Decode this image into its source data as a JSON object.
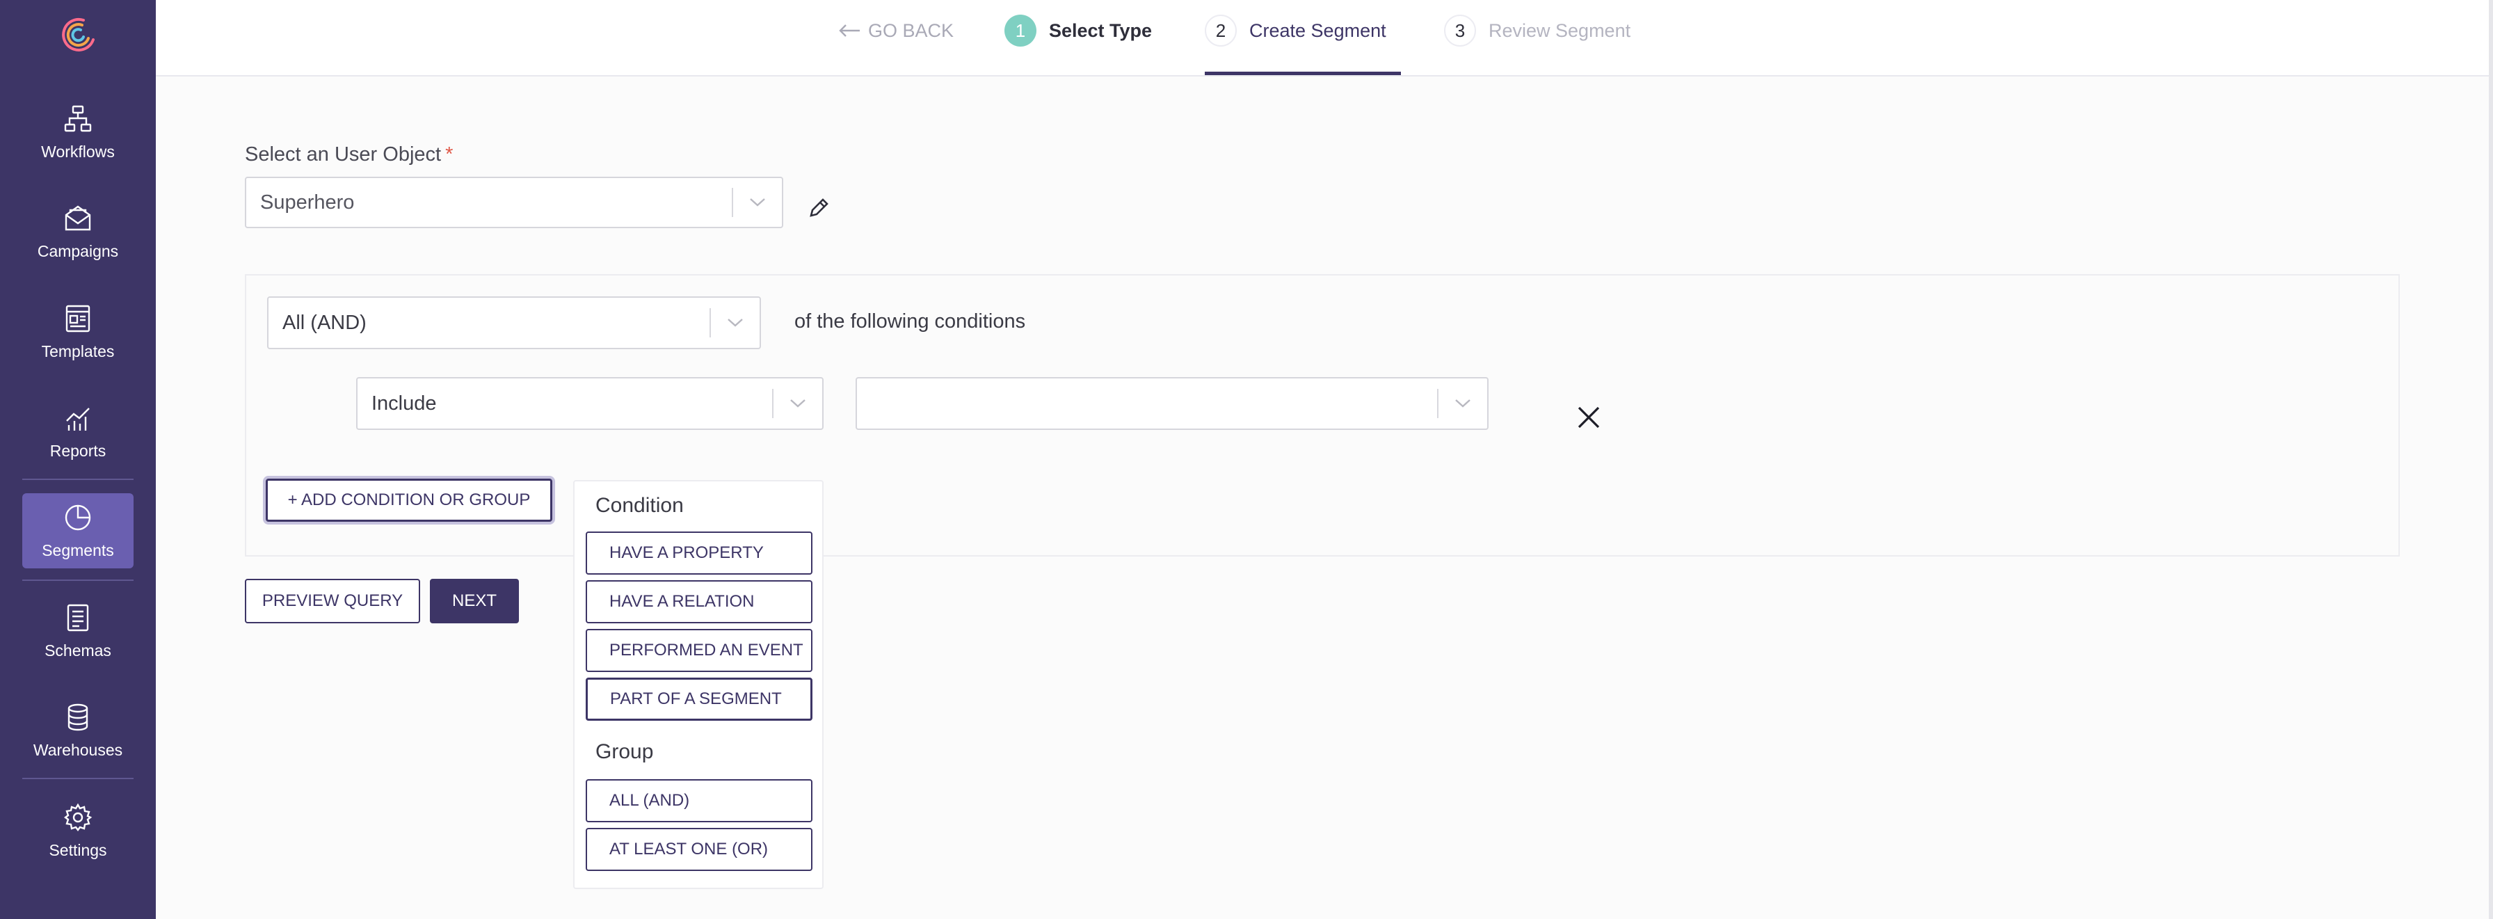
{
  "sidebar": {
    "items": [
      {
        "label": "Workflows",
        "icon": "workflow-icon"
      },
      {
        "label": "Campaigns",
        "icon": "envelope-icon"
      },
      {
        "label": "Templates",
        "icon": "template-icon"
      },
      {
        "label": "Reports",
        "icon": "chart-icon"
      },
      {
        "label": "Segments",
        "icon": "pie-icon",
        "active": true
      },
      {
        "label": "Schemas",
        "icon": "document-icon"
      },
      {
        "label": "Warehouses",
        "icon": "database-icon"
      },
      {
        "label": "Settings",
        "icon": "gear-icon"
      }
    ]
  },
  "topbar": {
    "go_back": "GO BACK",
    "steps": [
      {
        "num": "1",
        "label": "Select Type",
        "state": "completed"
      },
      {
        "num": "2",
        "label": "Create Segment",
        "state": "active"
      },
      {
        "num": "3",
        "label": "Review Segment",
        "state": "upcoming"
      }
    ]
  },
  "form": {
    "user_object_label": "Select an User Object",
    "required_mark": "*",
    "user_object_value": "Superhero",
    "match_value": "All (AND)",
    "match_suffix": "of the following conditions",
    "include_value": "Include",
    "condition_value": "",
    "add_button": "+ ADD CONDITION OR GROUP",
    "preview_button": "PREVIEW QUERY",
    "next_button": "NEXT"
  },
  "popup": {
    "condition_heading": "Condition",
    "condition_options": [
      "HAVE A PROPERTY",
      "HAVE A RELATION",
      "PERFORMED AN EVENT",
      "PART OF A SEGMENT"
    ],
    "group_heading": "Group",
    "group_options": [
      "ALL (AND)",
      "AT LEAST ONE (OR)"
    ]
  },
  "colors": {
    "sidebar_bg": "#3d3566",
    "sidebar_active": "#6a5fb0",
    "primary": "#3d3566",
    "step_done": "#7fd0c2",
    "required": "#e05a4a"
  }
}
